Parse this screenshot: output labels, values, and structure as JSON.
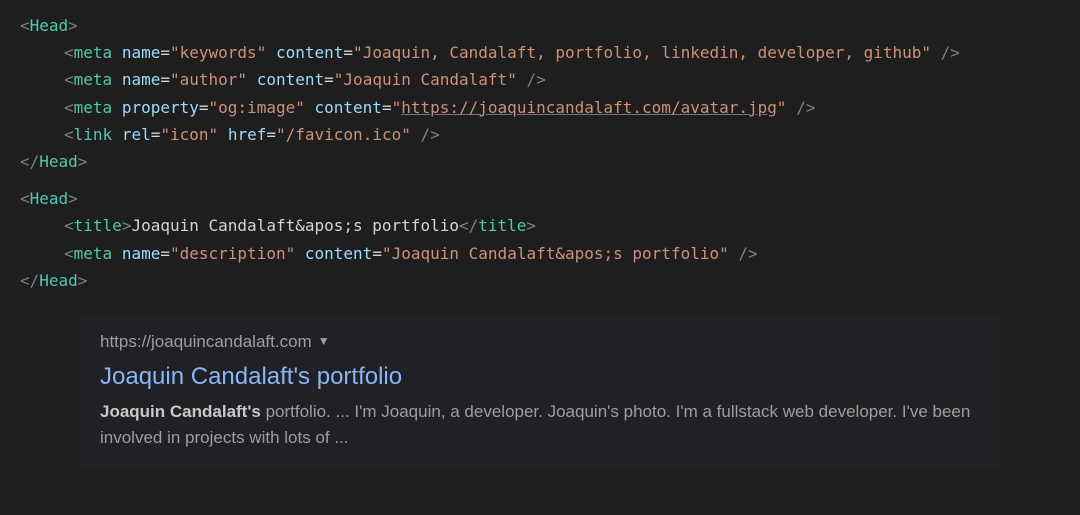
{
  "code": {
    "block1": {
      "open": "Head",
      "close": "Head",
      "lines": [
        {
          "tag": "meta",
          "attrs": [
            {
              "name": "name",
              "value": "keywords"
            },
            {
              "name": "content",
              "value": "Joaquin, Candalaft, portfolio, linkedin, developer, github"
            }
          ],
          "selfclose": true
        },
        {
          "tag": "meta",
          "attrs": [
            {
              "name": "name",
              "value": "author"
            },
            {
              "name": "content",
              "value": "Joaquin Candalaft"
            }
          ],
          "selfclose": true
        },
        {
          "tag": "meta",
          "attrs": [
            {
              "name": "property",
              "value": "og:image"
            },
            {
              "name": "content",
              "value": "https://joaquincandalaft.com/avatar.jpg",
              "underline": true
            }
          ],
          "selfclose": true
        },
        {
          "tag": "link",
          "attrs": [
            {
              "name": "rel",
              "value": "icon"
            },
            {
              "name": "href",
              "value": "/favicon.ico"
            }
          ],
          "selfclose": true
        }
      ]
    },
    "block2": {
      "open": "Head",
      "close": "Head",
      "titleLine": {
        "tag": "title",
        "text": "Joaquin Candalaft&apos;s portfolio"
      },
      "metaLine": {
        "tag": "meta",
        "attrs": [
          {
            "name": "name",
            "value": "description"
          },
          {
            "name": "content",
            "value": "Joaquin Candalaft&apos;s portfolio"
          }
        ],
        "selfclose": true
      }
    }
  },
  "searchResult": {
    "url": "https://joaquincandalaft.com",
    "title": "Joaquin Candalaft's portfolio",
    "descriptionBold": "Joaquin Candalaft's",
    "descriptionRest": " portfolio. ... I'm Joaquin, a developer. Joaquin's photo. I'm a fullstack web developer. I've been involved in projects with lots of ..."
  }
}
